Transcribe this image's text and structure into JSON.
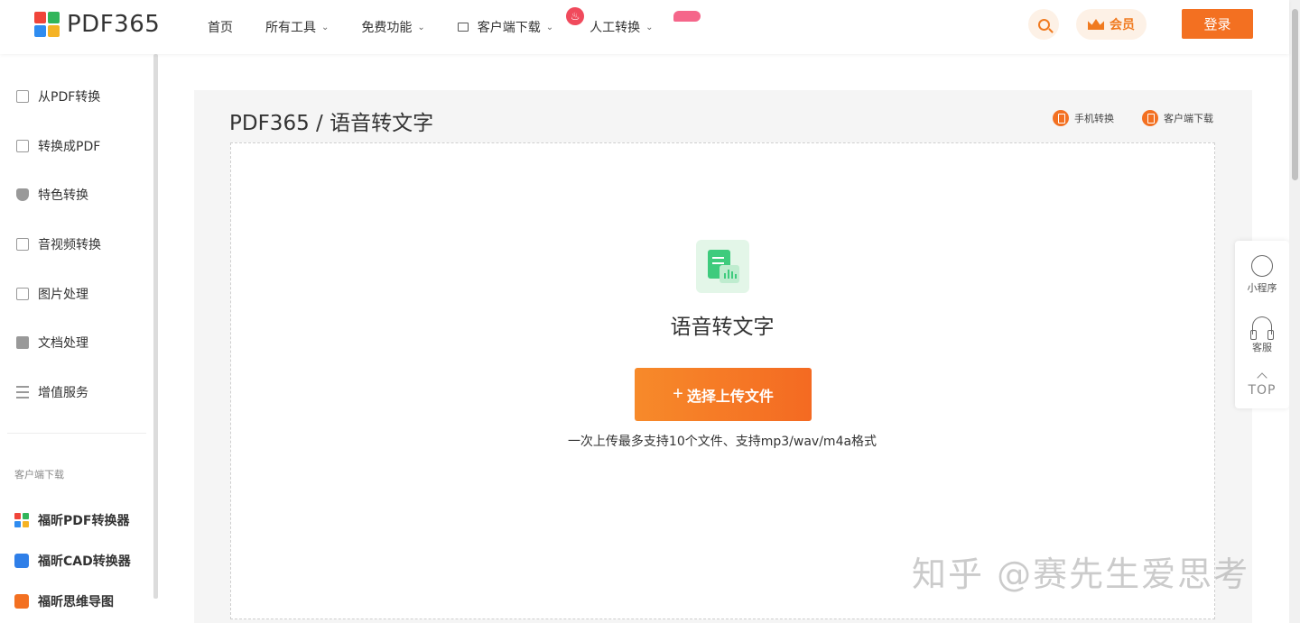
{
  "header": {
    "logo_text": "PDF365",
    "nav": [
      {
        "label": "首页"
      },
      {
        "label": "所有工具"
      },
      {
        "label": "免费功能"
      },
      {
        "label": "客户端下载"
      },
      {
        "label": "人工转换"
      }
    ],
    "vip_label": "会员",
    "login_label": "登录"
  },
  "sidebar": {
    "items": [
      {
        "label": "从PDF转换"
      },
      {
        "label": "转换成PDF"
      },
      {
        "label": "特色转换"
      },
      {
        "label": "音视频转换"
      },
      {
        "label": "图片处理"
      },
      {
        "label": "文档处理"
      },
      {
        "label": "增值服务"
      }
    ],
    "section_title": "客户端下载",
    "apps": [
      {
        "label": "福昕PDF转换器"
      },
      {
        "label": "福昕CAD转换器"
      },
      {
        "label": "福昕思维导图"
      }
    ]
  },
  "main": {
    "breadcrumb": "PDF365 / 语音转文字",
    "mobile_link": "手机转换",
    "client_link": "客户端下载",
    "tool_title": "语音转文字",
    "upload_label": "选择上传文件",
    "upload_hint": "一次上传最多支持10个文件、支持mp3/wav/m4a格式"
  },
  "floatbar": {
    "mini_program": "小程序",
    "service": "客服",
    "top": "TOP"
  },
  "watermark": "知乎 @赛先生爱思考",
  "colors": {
    "accent": "#f37021",
    "tool_green": "#3ecb7d",
    "panel_bg": "#f5f5f5"
  }
}
